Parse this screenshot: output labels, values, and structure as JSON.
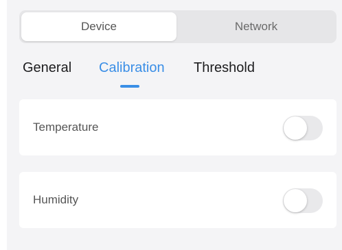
{
  "segmented": {
    "options": [
      "Device",
      "Network"
    ],
    "selected": "Device"
  },
  "tabs": {
    "items": [
      "General",
      "Calibration",
      "Threshold"
    ],
    "active": "Calibration"
  },
  "settings": [
    {
      "label": "Temperature",
      "enabled": false
    },
    {
      "label": "Humidity",
      "enabled": false
    }
  ],
  "colors": {
    "accent": "#3a8ee6",
    "background": "#f4f4f6",
    "card": "#ffffff",
    "toggle_off": "#e9e9eb"
  }
}
